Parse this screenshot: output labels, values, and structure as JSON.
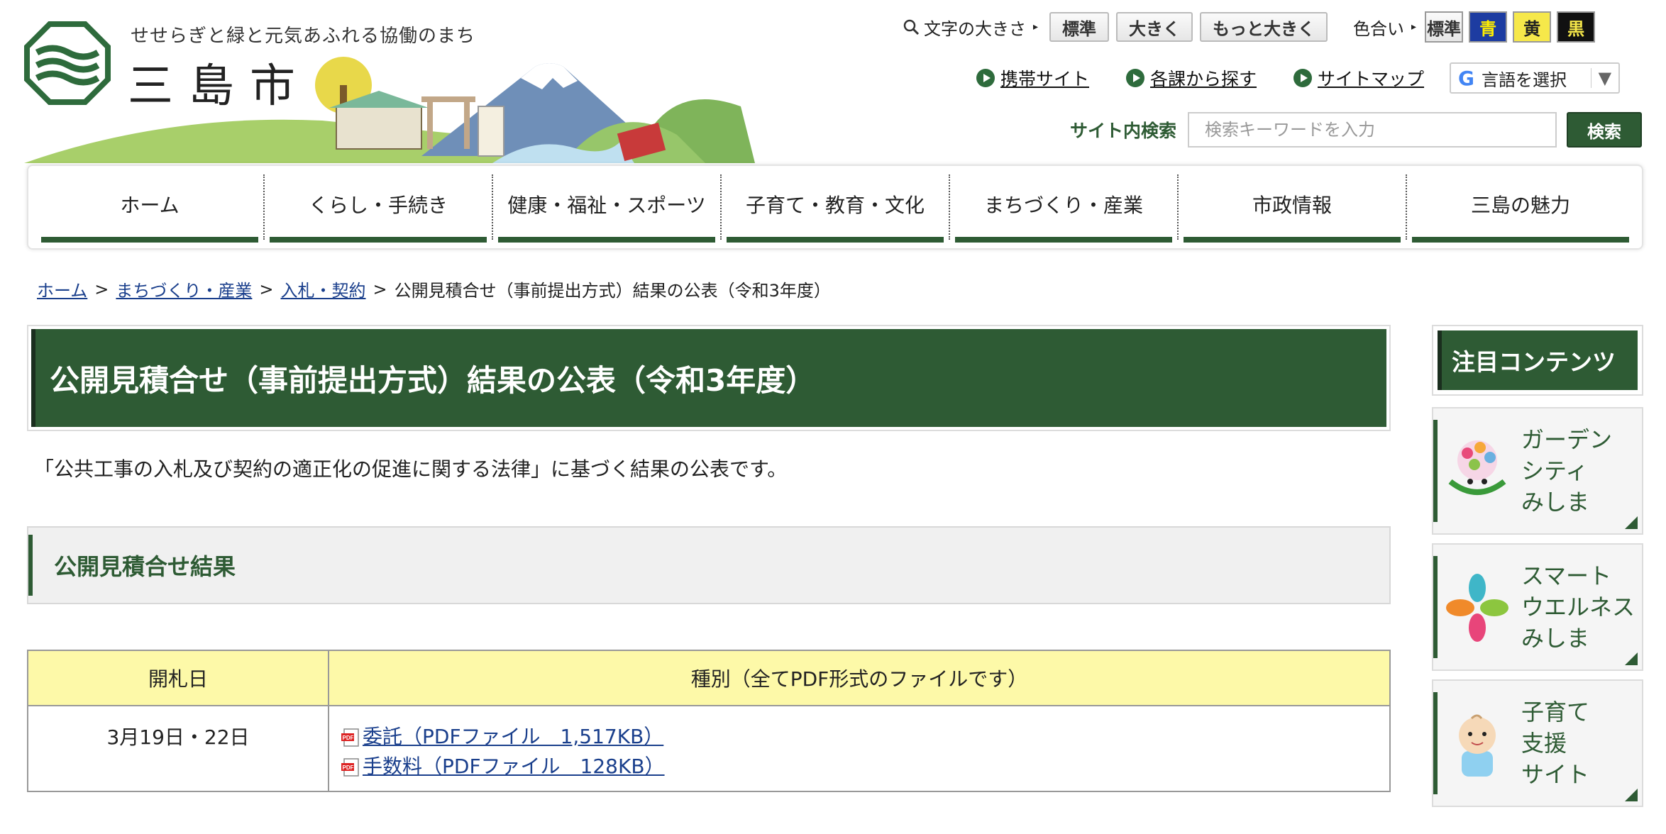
{
  "header": {
    "tagline": "せせらぎと緑と元気あふれる協働のまち",
    "city_name": "三島市",
    "font_size": {
      "label": "文字の大きさ",
      "options": [
        "標準",
        "大きく",
        "もっと大きく"
      ]
    },
    "color": {
      "label": "色合い",
      "options": [
        "標準",
        "青",
        "黄",
        "黒"
      ]
    },
    "links": [
      "携帯サイト",
      "各課から探す",
      "サイトマップ"
    ],
    "translate_label": "言語を選択",
    "search": {
      "label": "サイト内検索",
      "placeholder": "検索キーワードを入力",
      "button": "検索"
    }
  },
  "nav": [
    "ホーム",
    "くらし・手続き",
    "健康・福祉・スポーツ",
    "子育て・教育・文化",
    "まちづくり・産業",
    "市政情報",
    "三島の魅力"
  ],
  "breadcrumb": {
    "links": [
      "ホーム",
      "まちづくり・産業",
      "入札・契約"
    ],
    "current": "公開見積合せ（事前提出方式）結果の公表（令和3年度）",
    "separator": ">"
  },
  "main": {
    "title": "公開見積合せ（事前提出方式）結果の公表（令和3年度）",
    "lead": "「公共工事の入札及び契約の適正化の促進に関する法律」に基づく結果の公表です。",
    "section_heading": "公開見積合せ結果",
    "table": {
      "headers": [
        "開札日",
        "種別（全てPDF形式のファイルです）"
      ],
      "rows": [
        {
          "date": "3月19日・22日",
          "files": [
            "委託（PDFファイル　1,517KB）",
            "手数料（PDFファイル　128KB）"
          ]
        }
      ]
    }
  },
  "sidebar": {
    "title": "注目コンテンツ",
    "items": [
      {
        "lines": [
          "ガーデン",
          "シティ",
          "みしま"
        ],
        "icon": "garden-city-icon"
      },
      {
        "lines": [
          "スマート",
          "ウエルネス",
          "みしま"
        ],
        "icon": "smart-wellness-icon"
      },
      {
        "lines": [
          "子育て",
          "支援",
          "サイト"
        ],
        "icon": "baby-icon"
      }
    ]
  },
  "colors": {
    "brand_green": "#2e5b34",
    "table_header": "#fdf9a8",
    "link_blue": "#1a3f8c"
  }
}
